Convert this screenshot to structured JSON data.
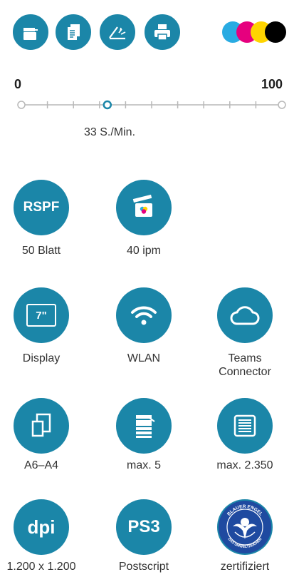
{
  "function_icons": [
    {
      "name": "copy-icon"
    },
    {
      "name": "document-stack-icon"
    },
    {
      "name": "scanner-icon"
    },
    {
      "name": "printer-icon"
    }
  ],
  "color_dots": [
    "#29abe2",
    "#e6007e",
    "#ffd400",
    "#000000"
  ],
  "speed": {
    "min_label": "0",
    "max_label": "100",
    "value": 33,
    "value_label": "33 S./Min."
  },
  "features": {
    "rspf": {
      "badge": "RSPF",
      "label": "50 Blatt"
    },
    "scan_speed": {
      "label": "40 ipm"
    },
    "display": {
      "badge": "7\"",
      "label": "Display"
    },
    "wlan": {
      "label": "WLAN"
    },
    "teams": {
      "label_line1": "Teams",
      "label_line2": "Connector"
    },
    "paper_size": {
      "label": "A6–A4"
    },
    "trays": {
      "label": "max. 5"
    },
    "capacity": {
      "label": "max. 2.350"
    },
    "resolution": {
      "badge": "dpi",
      "label": "1.200 x 1.200"
    },
    "postscript": {
      "badge": "PS3",
      "label": "Postscript"
    },
    "eco": {
      "label": "zertifiziert",
      "seal_text_top": "BLAUER ENGEL",
      "seal_text_bottom": "DAS UMWELTZEICHEN"
    }
  },
  "colors": {
    "accent": "#1b86a8",
    "seal": "#1f4aa0"
  }
}
